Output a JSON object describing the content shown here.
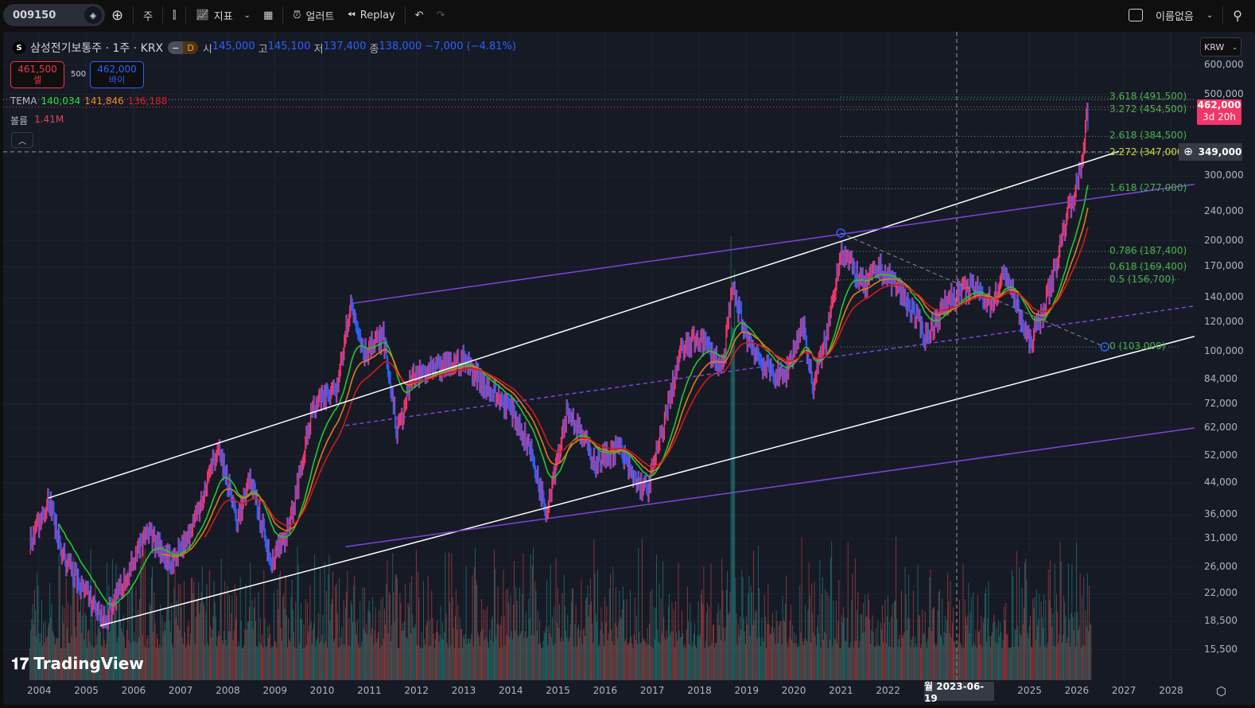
{
  "toolbar": {
    "symbol": "009150",
    "interval": "주",
    "indicators": "지표",
    "alert": "얼러트",
    "replay": "Replay",
    "layout_name": "이름없음"
  },
  "legend": {
    "badge": "S",
    "title": "삼성전기보통주 · 1주 · KRX",
    "session": "D",
    "open_label": "시",
    "open": "145,000",
    "high_label": "고",
    "high": "145,100",
    "low_label": "저",
    "low": "137,400",
    "close_label": "종",
    "close": "138,000",
    "change": "−7,000 (−4.81%)"
  },
  "order": {
    "sell_price": "461,500",
    "sell_label": "셀",
    "spread": "500",
    "buy_price": "462,000",
    "buy_label": "바이"
  },
  "tema": {
    "label": "TEMA",
    "v1": "140,034",
    "v2": "141,846",
    "v3": "136,188"
  },
  "volume": {
    "label": "볼륨",
    "value": "1.41M"
  },
  "axis": {
    "currency": "KRW",
    "current_price": "462,000",
    "countdown": "3d 20h",
    "crosshair_price": "349,000",
    "crosshair_date": "월 2023-06-19"
  },
  "colors": {
    "bg": "#161a25",
    "up": "#f23668",
    "down": "#2962ff",
    "tema1": "#22c832",
    "tema2": "#e07b1a",
    "tema3": "#d01a1a",
    "fib": "#4caf50",
    "channel": "#ffffff",
    "purple": "#7b45e0"
  },
  "chart_data": {
    "type": "line",
    "scale": "log",
    "ylim": [
      14000,
      650000
    ],
    "y_ticks": [
      600000,
      500000,
      300000,
      240000,
      200000,
      170000,
      140000,
      120000,
      100000,
      84000,
      72000,
      62000,
      52000,
      44000,
      36000,
      31000,
      26000,
      22000,
      18500,
      15500
    ],
    "y_tick_labels": [
      "600,000",
      "500,000",
      "300,000",
      "240,000",
      "200,000",
      "170,000",
      "140,000",
      "120,000",
      "100,000",
      "84,000",
      "72,000",
      "62,000",
      "52,000",
      "44,000",
      "36,000",
      "31,000",
      "26,000",
      "22,000",
      "18,500",
      "15,500"
    ],
    "x_ticks": [
      "2004",
      "2005",
      "2006",
      "2007",
      "2008",
      "2009",
      "2010",
      "2011",
      "2012",
      "2013",
      "2014",
      "2015",
      "2016",
      "2017",
      "2018",
      "2019",
      "2020",
      "2021",
      "2022",
      "2025",
      "2026",
      "2027",
      "2028"
    ],
    "x_tick_years": [
      2004,
      2005,
      2006,
      2007,
      2008,
      2009,
      2010,
      2011,
      2012,
      2013,
      2014,
      2015,
      2016,
      2017,
      2018,
      2019,
      2020,
      2021,
      2022,
      2025,
      2026,
      2027,
      2028
    ],
    "price": [
      [
        2003.8,
        30000
      ],
      [
        2004.2,
        40000
      ],
      [
        2004.5,
        28000
      ],
      [
        2005.0,
        22000
      ],
      [
        2005.4,
        18500
      ],
      [
        2005.8,
        24000
      ],
      [
        2006.3,
        32000
      ],
      [
        2006.8,
        27000
      ],
      [
        2007.2,
        32000
      ],
      [
        2007.8,
        55000
      ],
      [
        2008.2,
        35000
      ],
      [
        2008.5,
        45000
      ],
      [
        2008.9,
        27000
      ],
      [
        2009.3,
        33000
      ],
      [
        2009.8,
        70000
      ],
      [
        2010.3,
        80000
      ],
      [
        2010.6,
        135000
      ],
      [
        2010.9,
        100000
      ],
      [
        2011.3,
        110000
      ],
      [
        2011.6,
        60000
      ],
      [
        2011.9,
        85000
      ],
      [
        2012.5,
        90000
      ],
      [
        2013.0,
        95000
      ],
      [
        2013.5,
        80000
      ],
      [
        2014.0,
        70000
      ],
      [
        2014.4,
        55000
      ],
      [
        2014.75,
        37000
      ],
      [
        2015.2,
        70000
      ],
      [
        2015.8,
        50000
      ],
      [
        2016.3,
        55000
      ],
      [
        2016.6,
        45000
      ],
      [
        2016.9,
        42000
      ],
      [
        2017.2,
        60000
      ],
      [
        2017.6,
        100000
      ],
      [
        2018.0,
        110000
      ],
      [
        2018.5,
        90000
      ],
      [
        2018.7,
        150000
      ],
      [
        2019.0,
        110000
      ],
      [
        2019.4,
        90000
      ],
      [
        2019.8,
        85000
      ],
      [
        2020.2,
        120000
      ],
      [
        2020.4,
        80000
      ],
      [
        2020.7,
        110000
      ],
      [
        2021.0,
        190000
      ],
      [
        2021.5,
        150000
      ],
      [
        2021.8,
        170000
      ],
      [
        2022.2,
        150000
      ],
      [
        2022.5,
        130000
      ],
      [
        2022.8,
        110000
      ],
      [
        2023.3,
        140000
      ],
      [
        2023.8,
        150000
      ],
      [
        2024.2,
        135000
      ],
      [
        2024.5,
        165000
      ],
      [
        2024.8,
        125000
      ],
      [
        2025.0,
        105000
      ],
      [
        2025.3,
        130000
      ],
      [
        2025.6,
        180000
      ],
      [
        2025.8,
        240000
      ],
      [
        2026.0,
        280000
      ],
      [
        2026.15,
        350000
      ],
      [
        2026.2,
        470000
      ],
      [
        2026.25,
        400000
      ]
    ],
    "channels": [
      {
        "name": "upper-channel",
        "color": "white",
        "dash": false,
        "p1": [
          2004.2,
          40000
        ],
        "p2": [
          2026.9,
          350000
        ]
      },
      {
        "name": "lower-channel",
        "color": "white",
        "dash": false,
        "p1": [
          2005.3,
          18000
        ],
        "p2": [
          2028.5,
          110000
        ]
      },
      {
        "name": "purple-upper",
        "color": "purple",
        "dash": false,
        "p1": [
          2010.6,
          135000
        ],
        "p2": [
          2028.5,
          285000
        ]
      },
      {
        "name": "purple-lower",
        "color": "purple",
        "dash": false,
        "p1": [
          2010.5,
          29500
        ],
        "p2": [
          2028.5,
          62000
        ]
      },
      {
        "name": "purple-mid",
        "color": "purple",
        "dash": true,
        "p1": [
          2010.5,
          63000
        ],
        "p2": [
          2028.5,
          133000
        ]
      },
      {
        "name": "fib-trend",
        "color": "grey",
        "dash": true,
        "p1": [
          2021.0,
          210000
        ],
        "p2": [
          2026.6,
          103000
        ]
      }
    ],
    "fib_levels": [
      {
        "ratio": "3.618",
        "price": 491500,
        "label": "3.618 (491,500)"
      },
      {
        "ratio": "3.272",
        "price": 454500,
        "label": "3.272 (454,500)"
      },
      {
        "ratio": "2.618",
        "price": 384500,
        "label": "2.618 (384,500)"
      },
      {
        "ratio": "2.272",
        "price": 347000,
        "label": "2.272 (347,000)"
      },
      {
        "ratio": "1.618",
        "price": 277000,
        "label": "1.618 (277,000)"
      },
      {
        "ratio": "0.786",
        "price": 187400,
        "label": "0.786 (187,400)"
      },
      {
        "ratio": "0.618",
        "price": 169400,
        "label": "0.618 (169,400)"
      },
      {
        "ratio": "0.5",
        "price": 156700,
        "label": "0.5 (156,700)"
      },
      {
        "ratio": "0",
        "price": 103000,
        "label": "0 (103,000)"
      }
    ]
  },
  "branding": {
    "logo": "TradingView"
  }
}
